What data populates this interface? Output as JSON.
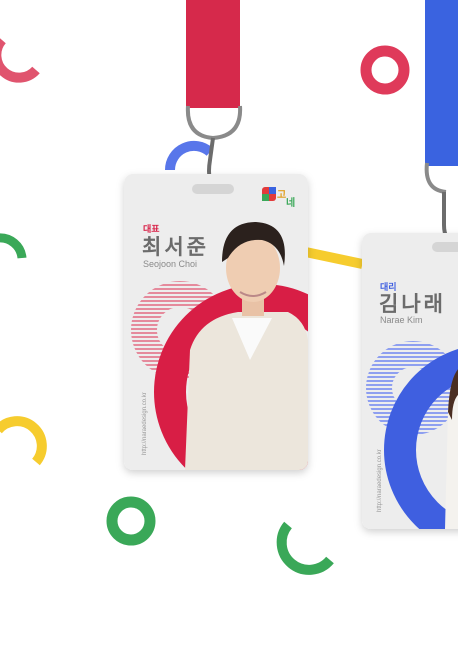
{
  "badges": [
    {
      "title": "대표",
      "name_ko": "최서준",
      "name_en": "Seojoon Choi",
      "url": "http://naraedesign.co.kr",
      "accent": "#d81e45",
      "lanyard_color": "#d6294b"
    },
    {
      "title": "대리",
      "name_ko": "김나래",
      "name_en": "Narae Kim",
      "url": "http://naraedesign.co.kr",
      "accent": "#3f5fe0",
      "lanyard_color": "#3a63e0"
    }
  ],
  "logo": {
    "text": "고고네"
  },
  "decor_colors": {
    "pink": "#e0546e",
    "red": "#df3a5a",
    "blue": "#5876ea",
    "green": "#3aa858",
    "yellow": "#f6cc2e"
  }
}
